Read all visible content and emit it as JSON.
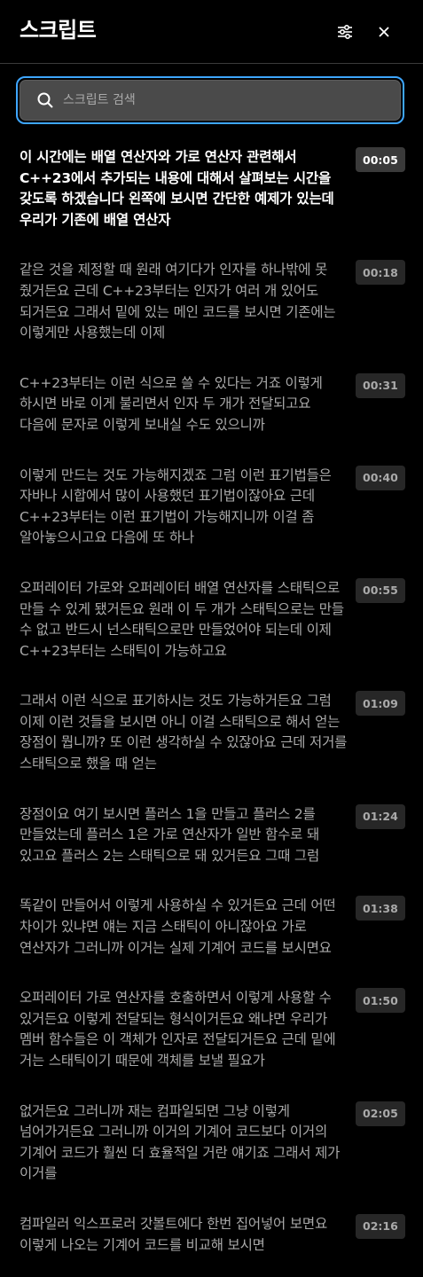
{
  "panel": {
    "title": "스크립트",
    "settings_icon": "sliders-icon",
    "close_icon": "close-icon"
  },
  "search": {
    "value": "",
    "placeholder": "스크립트 검색",
    "icon": "search-icon"
  },
  "colors": {
    "background": "#000000",
    "search_focus_border": "#3ea6ff",
    "search_fill": "#4a4a4a",
    "active_text": "#ffffff",
    "inactive_text": "#aaaaaa",
    "timestamp_bg": "#272727"
  },
  "segments": [
    {
      "time": "00:05",
      "text": "이 시간에는 배열 연산자와 가로 연산자 관련해서 C++23에서 추가되는 내용에 대해서 살펴보는 시간을 갖도록 하겠습니다 왼쪽에 보시면 간단한 예제가 있는데 우리가 기존에 배열 연산자",
      "active": true
    },
    {
      "time": "00:18",
      "text": "같은 것을 제정할 때 원래 여기다가 인자를 하나밖에 못 줬거든요 근데 C++23부터는 인자가 여러 개 있어도 되거든요 그래서 밑에 있는 메인 코드를 보시면 기존에는 이렇게만 사용했는데 이제",
      "active": false
    },
    {
      "time": "00:31",
      "text": "C++23부터는 이런 식으로 쓸 수 있다는 거죠 이렇게 하시면 바로 이게 불리면서 인자 두 개가 전달되고요 다음에 문자로 이렇게 보내실 수도 있으니까",
      "active": false
    },
    {
      "time": "00:40",
      "text": "이렇게 만드는 것도 가능해지겠죠 그럼 이런 표기법들은 자바나 시합에서 많이 사용했던 표기법이잖아요 근데 C++23부터는 이런 표기법이 가능해지니까 이걸 좀 알아놓으시고요 다음에 또 하나",
      "active": false
    },
    {
      "time": "00:55",
      "text": "오퍼레이터 가로와 오퍼레이터 배열 연산자를 스태틱으로 만들 수 있게 됐거든요 원래 이 두 개가 스태틱으로는 만들 수 없고 반드시 넌스태틱으로만 만들었어야 되는데 이제 C++23부터는 스태틱이 가능하고요",
      "active": false
    },
    {
      "time": "01:09",
      "text": "그래서 이런 식으로 표기하시는 것도 가능하거든요 그럼 이제 이런 것들을 보시면 아니 이걸 스태틱으로 해서 얻는 장점이 뭡니까? 또 이런 생각하실 수 있잖아요 근데 저거를 스태틱으로 했을 때 얻는",
      "active": false
    },
    {
      "time": "01:24",
      "text": "장점이요 여기 보시면 플러스 1을 만들고 플러스 2를 만들었는데 플러스 1은 가로 연산자가 일반 함수로 돼 있고요 플러스 2는 스태틱으로 돼 있거든요 그때 그럼",
      "active": false
    },
    {
      "time": "01:38",
      "text": "똑같이 만들어서 이렇게 사용하실 수 있거든요 근데 어떤 차이가 있냐면 얘는 지금 스태틱이 아니잖아요 가로 연산자가 그러니까 이거는 실제 기계어 코드를 보시면요",
      "active": false
    },
    {
      "time": "01:50",
      "text": "오퍼레이터 가로 연산자를 호출하면서 이렇게 사용할 수 있거든요 이렇게 전달되는 형식이거든요 왜냐면 우리가 멤버 함수들은 이 객체가 인자로 전달되거든요 근데 밑에 거는 스태틱이기 때문에 객체를 보낼 필요가",
      "active": false
    },
    {
      "time": "02:05",
      "text": "없거든요 그러니까 재는 컴파일되면 그냥 이렇게 넘어가거든요 그러니까 이거의 기계어 코드보다 이거의 기계어 코드가 훨씬 더 효율적일 거란 얘기죠 그래서 제가 이거를",
      "active": false
    },
    {
      "time": "02:16",
      "text": "컴파일러 익스프로러 갓볼트에다 한번 집어넣어 보면요 이렇게 나오는 기계어 코드를 비교해 보시면",
      "active": false
    }
  ]
}
